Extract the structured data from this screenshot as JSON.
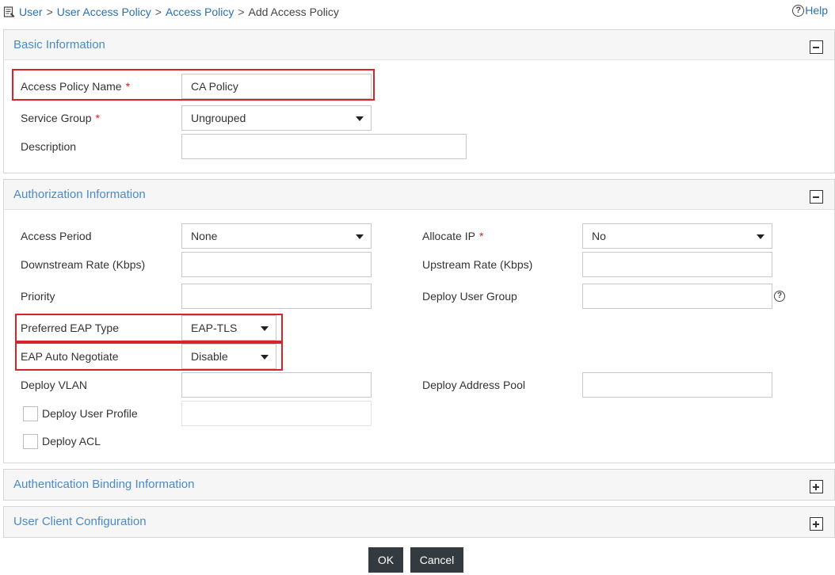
{
  "breadcrumb": {
    "items": [
      "User",
      "User Access Policy",
      "Access Policy"
    ],
    "separator": ">",
    "current": "Add Access Policy",
    "help_label": "Help"
  },
  "basic": {
    "title": "Basic Information",
    "policy_name_label": "Access Policy Name",
    "policy_name_value": "CA Policy",
    "service_group_label": "Service Group",
    "service_group_value": "Ungrouped",
    "description_label": "Description",
    "description_value": ""
  },
  "auth": {
    "title": "Authorization Information",
    "access_period_label": "Access Period",
    "access_period_value": "None",
    "allocate_ip_label": "Allocate IP",
    "allocate_ip_value": "No",
    "downstream_label": "Downstream Rate (Kbps)",
    "upstream_label": "Upstream Rate (Kbps)",
    "priority_label": "Priority",
    "deploy_user_group_label": "Deploy User Group",
    "eap_type_label": "Preferred EAP Type",
    "eap_type_value": "EAP-TLS",
    "eap_auto_label": "EAP Auto Negotiate",
    "eap_auto_value": "Disable",
    "deploy_vlan_label": "Deploy VLAN",
    "deploy_address_pool_label": "Deploy Address Pool",
    "deploy_user_profile_label": "Deploy User Profile",
    "deploy_acl_label": "Deploy ACL"
  },
  "binding": {
    "title": "Authentication Binding Information"
  },
  "client": {
    "title": "User Client Configuration"
  },
  "actions": {
    "ok_label": "OK",
    "cancel_label": "Cancel"
  },
  "required_mark": "*",
  "help_glyph": "?",
  "colors": {
    "accent": "#4a8ac6",
    "link": "#2a6fb0",
    "highlight": "#d9232a",
    "button": "#333a40",
    "required": "#d81e1e"
  }
}
